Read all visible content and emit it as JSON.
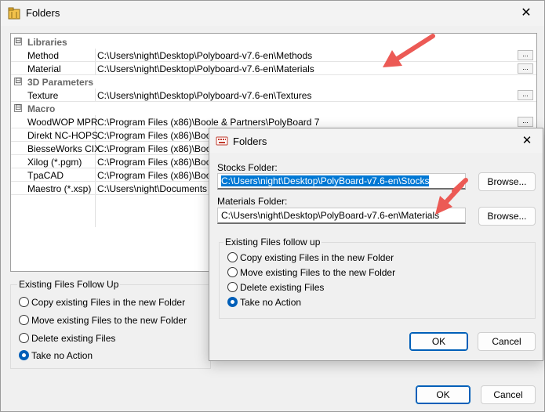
{
  "main": {
    "title": "Folders",
    "close_glyph": "✕",
    "colors": {
      "accent": "#005fb8",
      "arrow": "#ec5a55",
      "selection": "#0078d4"
    },
    "icons": {
      "app": "folders-app-icon",
      "close": "close-icon"
    },
    "grid": {
      "categories": [
        {
          "label": "Libraries",
          "toggle": "⊟"
        },
        {
          "label": "3D Parameters",
          "toggle": "⊟"
        },
        {
          "label": "Macro",
          "toggle": "⊟"
        }
      ],
      "rows": [
        {
          "name": "Method",
          "value": "C:\\Users\\night\\Desktop\\Polyboard-v7.6-en\\Methods"
        },
        {
          "name": "Material",
          "value": "C:\\Users\\night\\Desktop\\Polyboard-v7.6-en\\Materials"
        },
        {
          "name": "Texture",
          "value": "C:\\Users\\night\\Desktop\\Polyboard-v7.6-en\\Textures"
        },
        {
          "name": "WoodWOP MPR",
          "value": "C:\\Program Files (x86)\\Boole & Partners\\PolyBoard 7"
        },
        {
          "name": "Direkt NC-HOPS",
          "value": "C:\\Program Files (x86)\\Boole"
        },
        {
          "name": "BiesseWorks CIX",
          "value": "C:\\Program Files (x86)\\Boole"
        },
        {
          "name": "Xilog (*.pgm)",
          "value": "C:\\Program Files (x86)\\Boole"
        },
        {
          "name": "TpaCAD",
          "value": "C:\\Program Files (x86)\\Boole"
        },
        {
          "name": "Maestro (*.xsp)",
          "value": "C:\\Users\\night\\Documents"
        }
      ],
      "ellipsis": "..."
    },
    "followup": {
      "legend": "Existing Files Follow Up",
      "options": [
        "Copy existing Files in the new Folder",
        "Move existing Files to the new Folder",
        "Delete existing Files",
        "Take no Action"
      ],
      "selected_index": 3
    },
    "ok_label": "OK",
    "cancel_label": "Cancel"
  },
  "dialog": {
    "title": "Folders",
    "close_glyph": "✕",
    "icons": {
      "app": "keyboard-icon",
      "close": "close-icon"
    },
    "stocks_label": "Stocks Folder:",
    "stocks_value": "C:\\Users\\night\\Desktop\\PolyBoard-v7.6-en\\Stocks",
    "materials_label": "Materials Folder:",
    "materials_value": "C:\\Users\\night\\Desktop\\PolyBoard-v7.6-en\\Materials",
    "browse_label": "Browse...",
    "followup": {
      "legend": "Existing Files follow up",
      "options": [
        "Copy existing Files in the new Folder",
        "Move existing Files to the new Folder",
        "Delete existing Files",
        "Take no Action"
      ],
      "selected_index": 3
    },
    "ok_label": "OK",
    "cancel_label": "Cancel"
  }
}
